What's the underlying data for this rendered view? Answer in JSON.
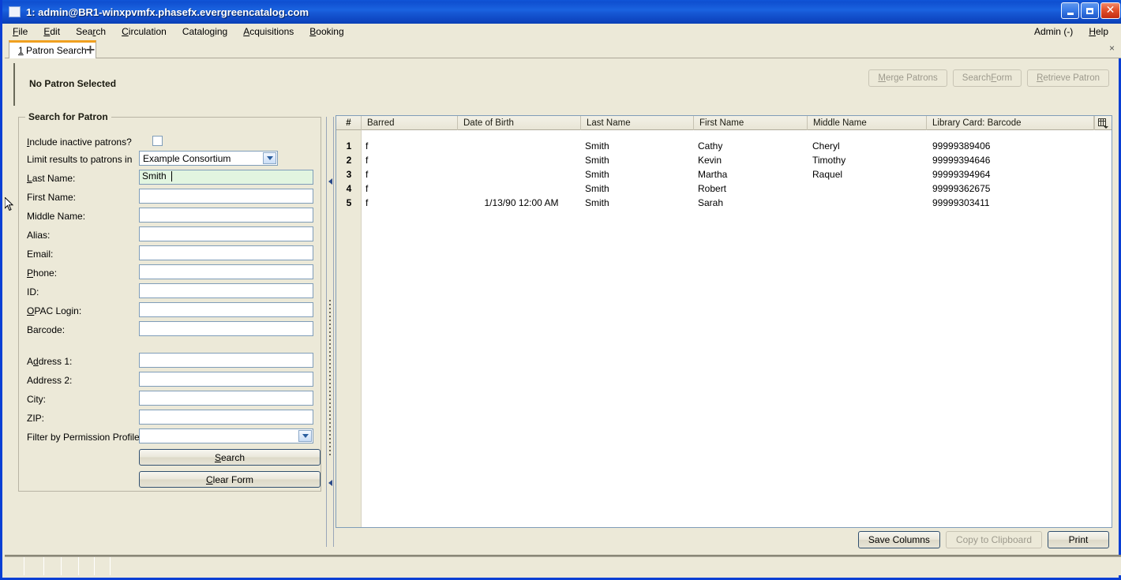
{
  "window": {
    "title": "1: admin@BR1-winxpvmfx.phasefx.evergreencatalog.com",
    "icon": "window-icon",
    "minimize_label": "",
    "maximize_label": "",
    "close_label": "✕"
  },
  "menubar": {
    "items": [
      {
        "label": "File",
        "mnemonic_index": 0
      },
      {
        "label": "Edit",
        "mnemonic_index": 0
      },
      {
        "label": "Search",
        "mnemonic_index": 3
      },
      {
        "label": "Circulation",
        "mnemonic_index": 0
      },
      {
        "label": "Cataloging",
        "mnemonic_index": 6
      },
      {
        "label": "Acquisitions",
        "mnemonic_index": 0
      },
      {
        "label": "Booking",
        "mnemonic_index": 0
      }
    ],
    "admin_label": "Admin (-)",
    "help_label": "Help"
  },
  "tabbar": {
    "active_tab": "1 Patron Search",
    "add_tab_label": "+",
    "close_label": "×"
  },
  "patron_header": {
    "status": "No Patron Selected",
    "buttons": [
      {
        "label": "Merge Patrons",
        "enabled": false
      },
      {
        "label": "Search Form",
        "enabled": false
      },
      {
        "label": "Retrieve Patron",
        "enabled": false
      }
    ]
  },
  "search_form": {
    "group_title": "Search for Patron",
    "fields": [
      {
        "label": "Include inactive patrons?",
        "type": "checkbox",
        "value": "",
        "checked": false
      },
      {
        "label": "Limit results to patrons in",
        "type": "select",
        "value": "Example Consortium"
      },
      {
        "label": "Last Name:",
        "type": "text",
        "value": "Smith",
        "focused": true
      },
      {
        "label": "First Name:",
        "type": "text",
        "value": ""
      },
      {
        "label": "Middle Name:",
        "type": "text",
        "value": ""
      },
      {
        "label": "Alias:",
        "type": "text",
        "value": ""
      },
      {
        "label": "Email:",
        "type": "text",
        "value": ""
      },
      {
        "label": "Phone:",
        "type": "text",
        "value": ""
      },
      {
        "label": "ID:",
        "type": "text",
        "value": ""
      },
      {
        "label": "OPAC Login:",
        "type": "text",
        "value": ""
      },
      {
        "label": "Barcode:",
        "type": "text",
        "value": ""
      },
      {
        "label": "Address 1:",
        "type": "text",
        "value": ""
      },
      {
        "label": "Address 2:",
        "type": "text",
        "value": ""
      },
      {
        "label": "City:",
        "type": "text",
        "value": ""
      },
      {
        "label": "ZIP:",
        "type": "text",
        "value": ""
      },
      {
        "label": "Filter by Permission Profile:",
        "type": "select",
        "value": ""
      }
    ],
    "search_button": "Search",
    "clear_button": "Clear Form"
  },
  "results": {
    "columns": [
      "#",
      "Barred",
      "Date of Birth",
      "Last Name",
      "First Name",
      "Middle Name",
      "Library Card: Barcode"
    ],
    "column_picker_icon": "column-picker-icon",
    "rows": [
      {
        "num": "1",
        "barred": "f",
        "dob": "",
        "last": "Smith",
        "first": "Cathy",
        "middle": "Cheryl",
        "barcode": "99999389406"
      },
      {
        "num": "2",
        "barred": "f",
        "dob": "",
        "last": "Smith",
        "first": "Kevin",
        "middle": "Timothy",
        "barcode": "99999394646"
      },
      {
        "num": "3",
        "barred": "f",
        "dob": "",
        "last": "Smith",
        "first": "Martha",
        "middle": "Raquel",
        "barcode": "99999394964"
      },
      {
        "num": "4",
        "barred": "f",
        "dob": "",
        "last": "Smith",
        "first": "Robert",
        "middle": "",
        "barcode": "99999362675"
      },
      {
        "num": "5",
        "barred": "f",
        "dob": "1/13/90 12:00 AM",
        "last": "Smith",
        "first": "Sarah",
        "middle": "",
        "barcode": "99999303411"
      }
    ],
    "buttons": [
      {
        "label": "Save Columns",
        "enabled": true
      },
      {
        "label": "Copy to Clipboard",
        "enabled": false
      },
      {
        "label": "Print",
        "enabled": true
      }
    ]
  },
  "statusbar": {
    "cells": [
      "",
      "",
      "",
      "",
      "",
      "",
      ""
    ]
  },
  "colors": {
    "titlebar_blue": "#1759d6",
    "window_border": "#0a3fd4",
    "panel_bg": "#ece9d8",
    "active_tab_accent": "#f0a020",
    "focused_field_bg": "#e2f5e0",
    "input_border": "#7f9db9"
  }
}
